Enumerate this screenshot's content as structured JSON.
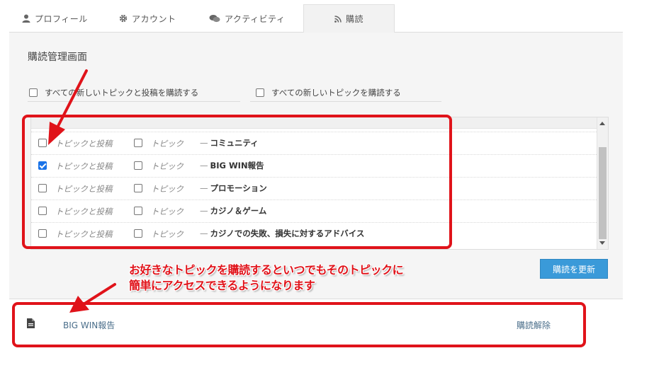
{
  "tabs": [
    {
      "label": "プロフィール",
      "icon": "user-icon"
    },
    {
      "label": "アカウント",
      "icon": "gear-icon"
    },
    {
      "label": "アクティビティ",
      "icon": "comments-icon"
    },
    {
      "label": "購読",
      "icon": "rss-icon",
      "active": true
    }
  ],
  "panel": {
    "title": "購読管理画面",
    "all_options": [
      {
        "label": "すべての新しいトピックと投稿を購読する",
        "checked": false
      },
      {
        "label": "すべての新しいトピックを購読する",
        "checked": false
      }
    ],
    "topic_label": "トピックと投稿",
    "topic_only_label": "トピック",
    "dash": "—",
    "forums": [
      {
        "name": "コミュニティ",
        "topics_posts": false,
        "topics": false
      },
      {
        "name": "BIG WIN報告",
        "topics_posts": true,
        "topics": false
      },
      {
        "name": "プロモーション",
        "topics_posts": false,
        "topics": false
      },
      {
        "name": "カジノ＆ゲーム",
        "topics_posts": false,
        "topics": false
      },
      {
        "name": "カジノでの失敗、損失に対するアドバイス",
        "topics_posts": false,
        "topics": false
      }
    ],
    "update_button": "購読を更新"
  },
  "subscribed": {
    "item_title": "BIG WIN報告",
    "unsubscribe": "購読解除"
  },
  "annotation": {
    "line1": "お好きなトピックを購読するといつでもそのトピックに",
    "line2": "簡単にアクセスできるようになります",
    "color": "#e0131a"
  },
  "colors": {
    "accent_button": "#3a9ad9",
    "link": "#4a6e8a",
    "checkbox_checked": "#1a73e8"
  }
}
